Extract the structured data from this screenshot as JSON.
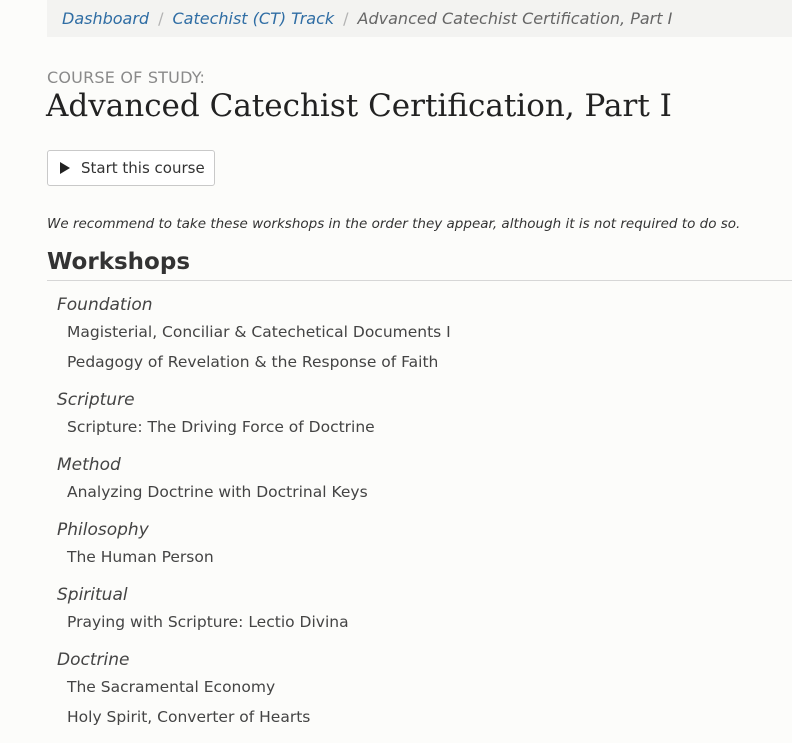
{
  "breadcrumb": {
    "items": [
      "Dashboard",
      "Catechist (CT) Track"
    ],
    "separator": "/",
    "current": "Advanced Catechist Certification, Part I"
  },
  "course": {
    "label": "COURSE OF STUDY:",
    "title": "Advanced Catechist Certification, Part I",
    "start_label": "Start this course",
    "recommendation": "We recommend to take these workshops in the order they appear, although it is not required to do so."
  },
  "workshops": {
    "heading": "Workshops",
    "groups": [
      {
        "title": "Foundation",
        "items": [
          "Magisterial, Conciliar & Catechetical Documents I",
          "Pedagogy of Revelation & the Response of Faith"
        ]
      },
      {
        "title": "Scripture",
        "items": [
          "Scripture: The Driving Force of Doctrine"
        ]
      },
      {
        "title": "Method",
        "items": [
          "Analyzing Doctrine with Doctrinal Keys"
        ]
      },
      {
        "title": "Philosophy",
        "items": [
          "The Human Person"
        ]
      },
      {
        "title": "Spiritual",
        "items": [
          "Praying with Scripture: Lectio Divina"
        ]
      },
      {
        "title": "Doctrine",
        "items": [
          "The Sacramental Economy",
          "Holy Spirit, Converter of Hearts"
        ]
      }
    ]
  },
  "colors": {
    "link": "#2f6da4",
    "background": "#fcfcfa",
    "breadcrumb_bg": "#f3f3f1"
  },
  "icons": {
    "start_button": "play-icon"
  }
}
